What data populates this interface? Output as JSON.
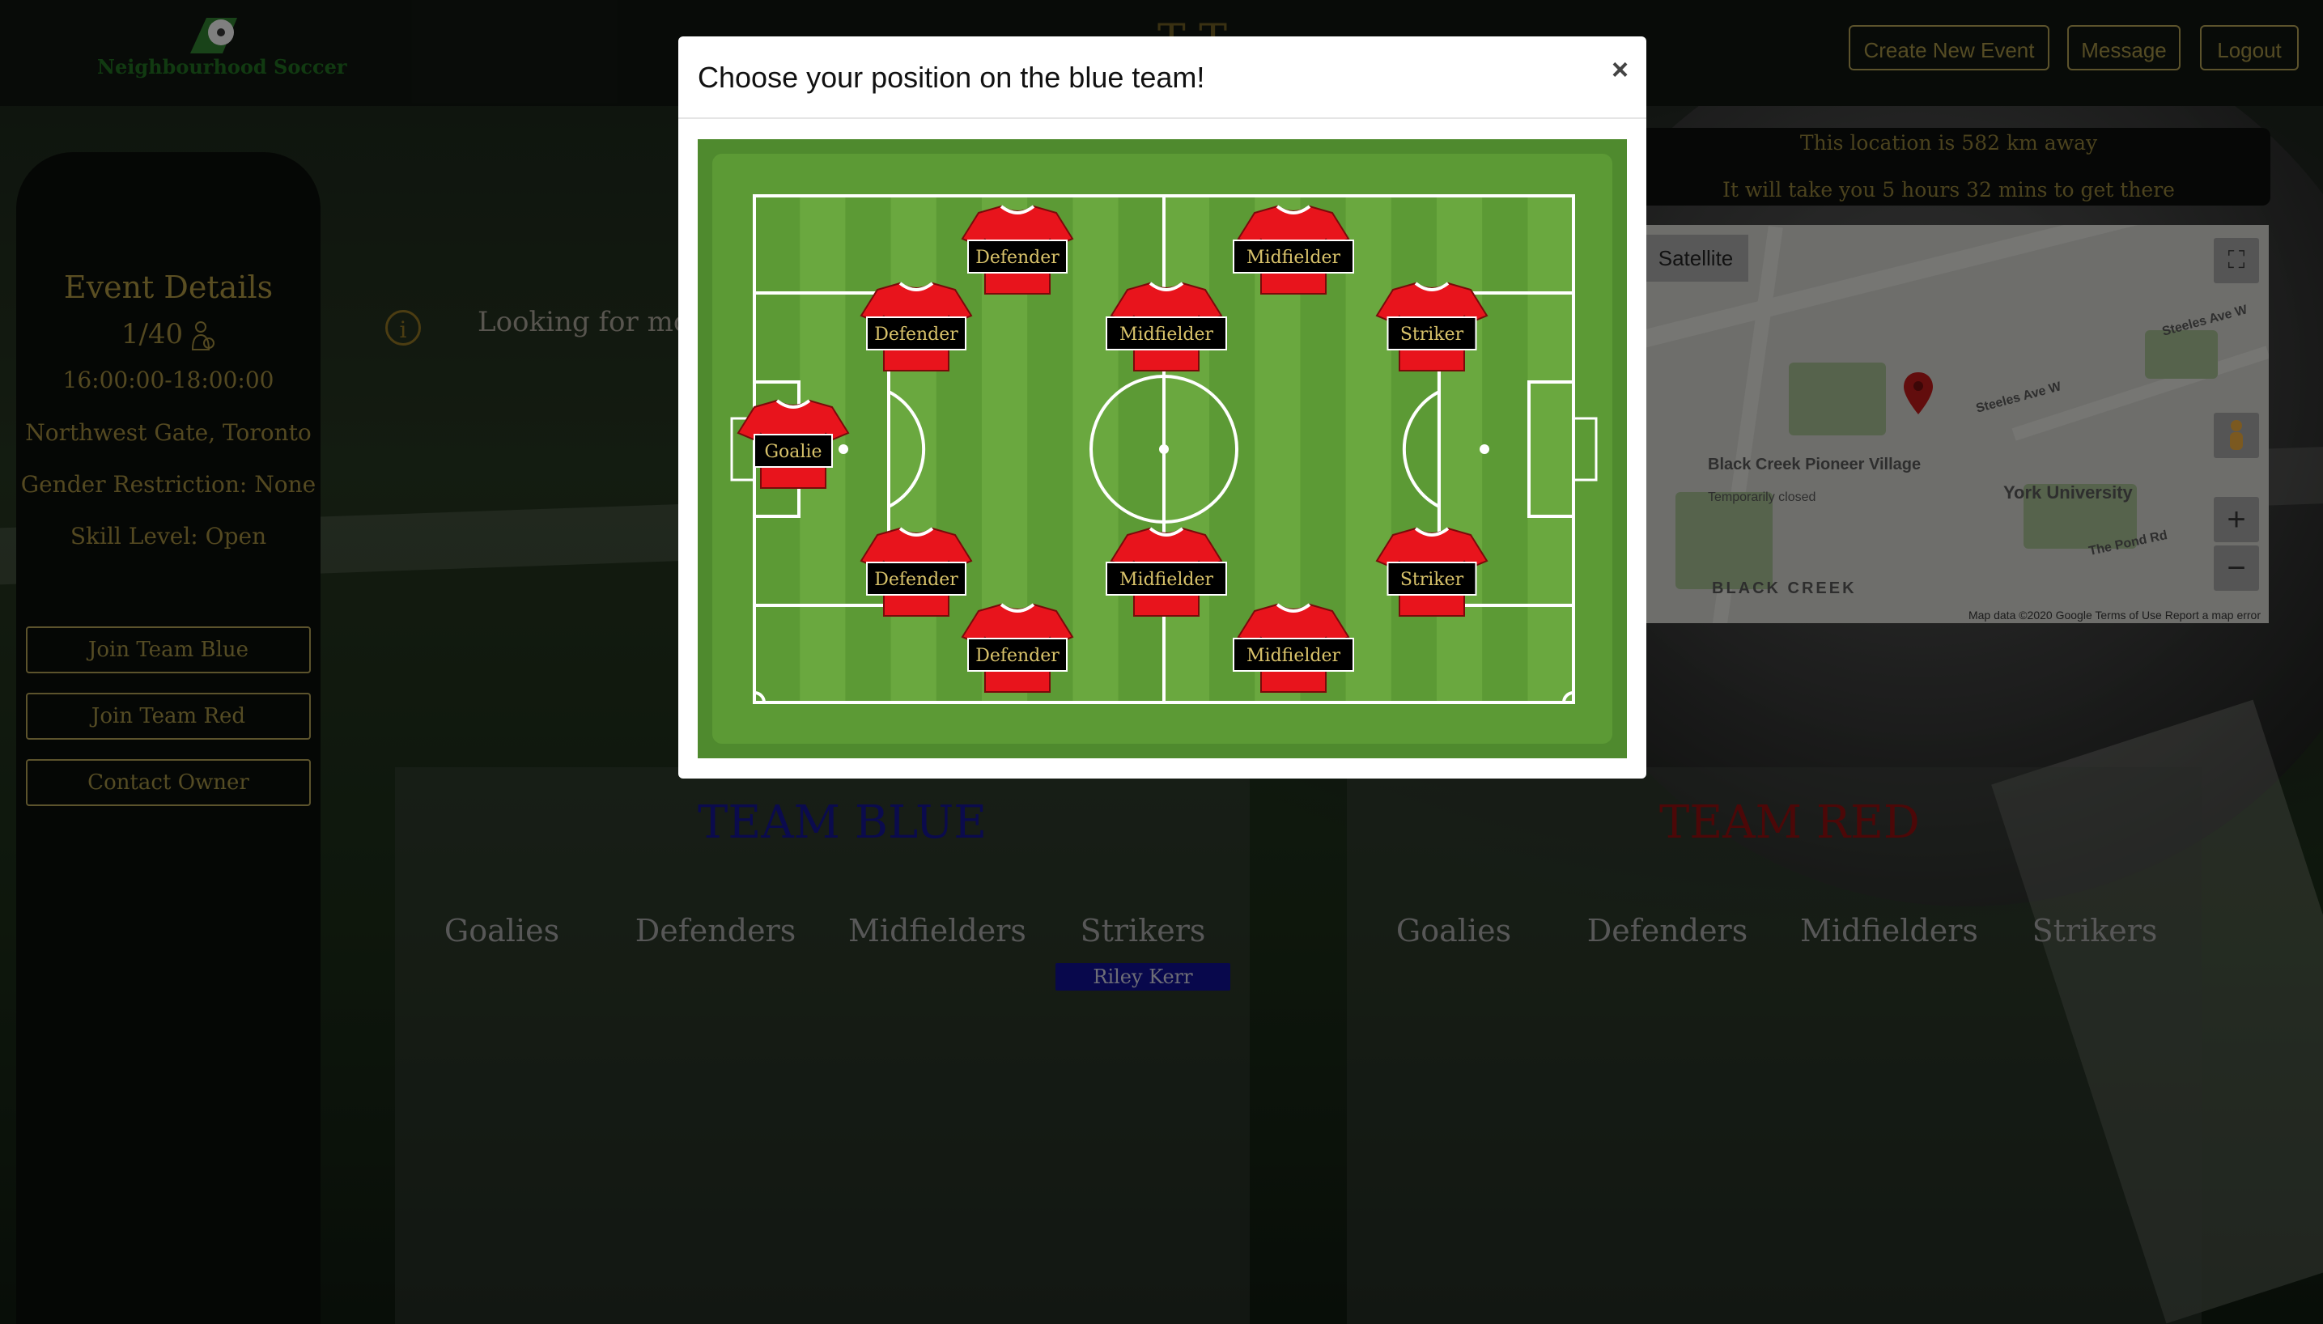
{
  "nav": {
    "logo_text": "Neighbourhood Soccer",
    "buttons": [
      "Create New Event",
      "Message",
      "Logout"
    ]
  },
  "sidebar": {
    "title": "Event Details",
    "count": "1/40",
    "time": "16:00:00-18:00:00",
    "location": "Northwest Gate, Toronto",
    "gender": "Gender Restriction: None",
    "skill": "Skill Level: Open",
    "buttons": [
      "Join Team Blue",
      "Join Team Red",
      "Contact Owner"
    ]
  },
  "info": {
    "text": "Looking for more"
  },
  "travel": {
    "distance": "This location is 582 km away",
    "duration": "It will take you 5 hours 32 mins to get there"
  },
  "map": {
    "satellite_label": "Satellite",
    "labels": [
      "Steeles Ave W",
      "Steeles Ave W",
      "Black Creek Pioneer Village",
      "Temporarily closed",
      "York University",
      "BLACK CREEK",
      "The Pond Rd"
    ],
    "footer": "Map data ©2020 Google   Terms of Use   Report a map error",
    "zoom_in": "+",
    "zoom_out": "−"
  },
  "teams": {
    "blue": {
      "title": "TEAM BLUE",
      "color": "#14148c",
      "columns": [
        "Goalies",
        "Defenders",
        "Midfielders",
        "Strikers"
      ],
      "strikers": [
        "Riley Kerr"
      ]
    },
    "red": {
      "title": "TEAM RED",
      "color": "#8a1010",
      "columns": [
        "Goalies",
        "Defenders",
        "Midfielders",
        "Strikers"
      ]
    }
  },
  "modal": {
    "title": "Choose your position on the blue team!",
    "close": "×",
    "positions": {
      "goalie": "Goalie",
      "def1": "Defender",
      "def2": "Defender",
      "def3": "Defender",
      "def4": "Defender",
      "mid1": "Midfielder",
      "mid2": "Midfielder",
      "mid3": "Midfielder",
      "mid4": "Midfielder",
      "str1": "Striker",
      "str2": "Striker"
    },
    "jersey_color": "#e8141c"
  }
}
